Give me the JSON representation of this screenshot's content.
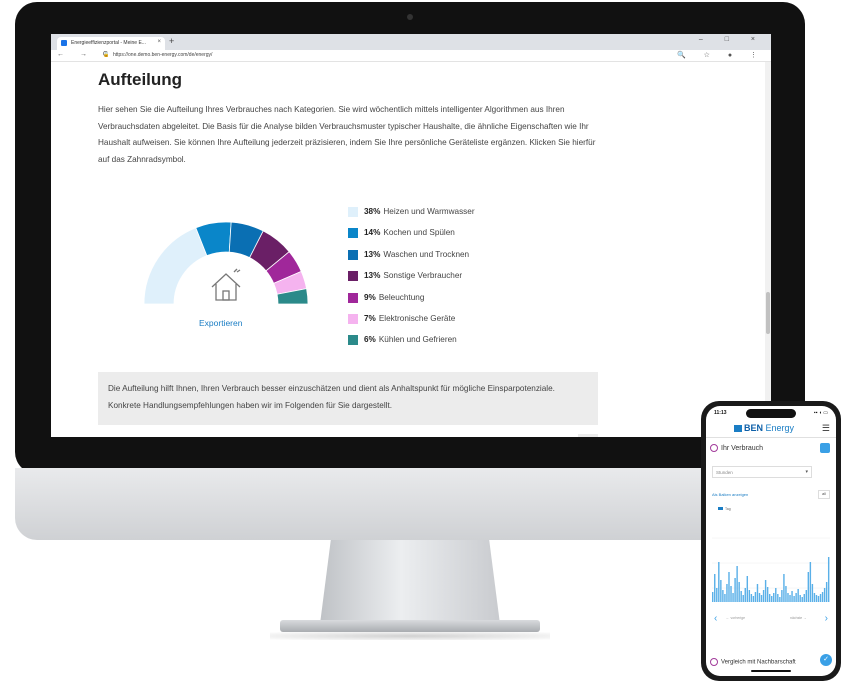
{
  "browser": {
    "tab_title": "Energieeffizienzportal - Meine E...",
    "tab_close": "×",
    "new_tab": "+",
    "window_controls": "–  □  ×",
    "nav": "←  →  C",
    "url": "https://one.demo.ben-energy.com/de/energy/",
    "right_icons": "🔍 ☆ ● ⋮"
  },
  "page": {
    "heading": "Aufteilung",
    "paragraph": "Hier sehen Sie die Aufteilung Ihres Verbrauches nach Kategorien. Sie wird wöchentlich mittels intelligenter Algorithmen aus Ihren Verbrauchsdaten abgeleitet. Die Basis für die Analyse bilden Verbrauchsmuster typischer Haushalte, die ähnliche Eigenschaften wie Ihr Haushalt aufweisen. Sie können Ihre Aufteilung jederzeit präzisieren, indem Sie Ihre persönliche Geräteliste ergänzen. Klicken Sie hierfür auf das Zahnradsymbol.",
    "export_label": "Exportieren",
    "info_text": "Die Aufteilung hilft Ihnen, Ihren Verbrauch besser einzuschätzen und dient als Anhaltspunkt für mögliche Einsparpotenziale. Konkrete Handlungsempfehlungen haben wir im Folgenden für Sie dargestellt.",
    "gear_icon": "gear-icon"
  },
  "chart_data": {
    "type": "pie",
    "variant": "half-donut",
    "categories": [
      "Heizen und Warmwasser",
      "Kochen und Spülen",
      "Waschen und Trocknen",
      "Sonstige Verbraucher",
      "Beleuchtung",
      "Elektronische Geräte",
      "Kühlen und Gefrieren"
    ],
    "values": [
      38,
      14,
      13,
      13,
      9,
      7,
      6
    ],
    "labels": [
      "38%",
      "14%",
      "13%",
      "13%",
      "9%",
      "7%",
      "6%"
    ],
    "colors": [
      "#dff0fb",
      "#0a86c9",
      "#0a6fb3",
      "#6a1f66",
      "#a0279a",
      "#f5b3ef",
      "#2b8a8a"
    ],
    "center_icon": "house-icon"
  },
  "phone": {
    "time": "11:13",
    "status_right": "▪▪ ◖ ▭",
    "brand_bold": "BEN",
    "brand_rest": " Energy",
    "menu_icon": "☰",
    "section_title": "Ihr Verbrauch",
    "select_value": "Stunden",
    "select_caret": "▾",
    "small_link": "Als Balken anzeigen",
    "all_label": "all",
    "legend_label": "Tag",
    "pager_prev": "‹",
    "pager_next": "›",
    "pager_left_text": "← vorherige",
    "pager_right_text": "nächste →",
    "section2_title": "Vergleich mit Nachbarschaft",
    "check": "✓"
  }
}
